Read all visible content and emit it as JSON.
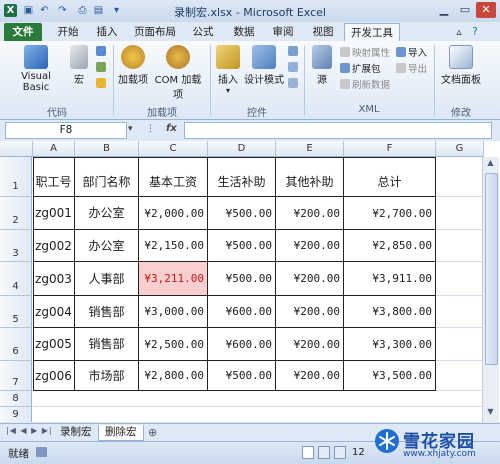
{
  "window": {
    "title": "录制宏.xlsx - Microsoft Excel"
  },
  "tabs": [
    "文件",
    "开始",
    "插入",
    "页面布局",
    "公式",
    "数据",
    "审阅",
    "视图",
    "开发工具"
  ],
  "ribbon": {
    "code": {
      "visual_basic": "Visual Basic",
      "macro": "宏",
      "label": "代码"
    },
    "addins": {
      "addin": "加载项",
      "com_addin": "COM 加载项",
      "label": "加载项"
    },
    "controls": {
      "insert": "插入",
      "design_mode": "设计模式",
      "label": "控件"
    },
    "source": "源",
    "xml": {
      "map_props": "映射属性",
      "expansion": "扩展包",
      "refresh": "刷新数据",
      "import": "导入",
      "export": "导出",
      "label": "XML"
    },
    "modify": {
      "doc_panel": "文档面板",
      "label": "修改"
    }
  },
  "formula_bar": {
    "name_box": "F8",
    "fx": "fx",
    "value": ""
  },
  "columns": [
    "A",
    "B",
    "C",
    "D",
    "E",
    "F",
    "G"
  ],
  "rows": [
    "1",
    "2",
    "3",
    "4",
    "5",
    "6",
    "7",
    "8",
    "9"
  ],
  "table": {
    "headers": [
      "职工号",
      "部门名称",
      "基本工资",
      "生活补助",
      "其他补助",
      "总计"
    ],
    "data": [
      [
        "zg001",
        "办公室",
        "¥2,000.00",
        "¥500.00",
        "¥200.00",
        "¥2,700.00"
      ],
      [
        "zg002",
        "办公室",
        "¥2,150.00",
        "¥500.00",
        "¥200.00",
        "¥2,850.00"
      ],
      [
        "zg003",
        "人事部",
        "¥3,211.00",
        "¥500.00",
        "¥200.00",
        "¥3,911.00"
      ],
      [
        "zg004",
        "销售部",
        "¥3,000.00",
        "¥600.00",
        "¥200.00",
        "¥3,800.00"
      ],
      [
        "zg005",
        "销售部",
        "¥2,500.00",
        "¥600.00",
        "¥200.00",
        "¥3,300.00"
      ],
      [
        "zg006",
        "市场部",
        "¥2,800.00",
        "¥500.00",
        "¥200.00",
        "¥3,500.00"
      ]
    ]
  },
  "sheets": [
    "录制宏",
    "删除宏"
  ],
  "status": {
    "ready": "就绪",
    "zoom": "12"
  },
  "watermark": {
    "brand": "雪花家园",
    "url": "www.xhjaty.com"
  },
  "colors": {
    "file_tab": "#2a7a3a",
    "highlight_fill": "#f8cece",
    "highlight_text": "#c41818"
  }
}
